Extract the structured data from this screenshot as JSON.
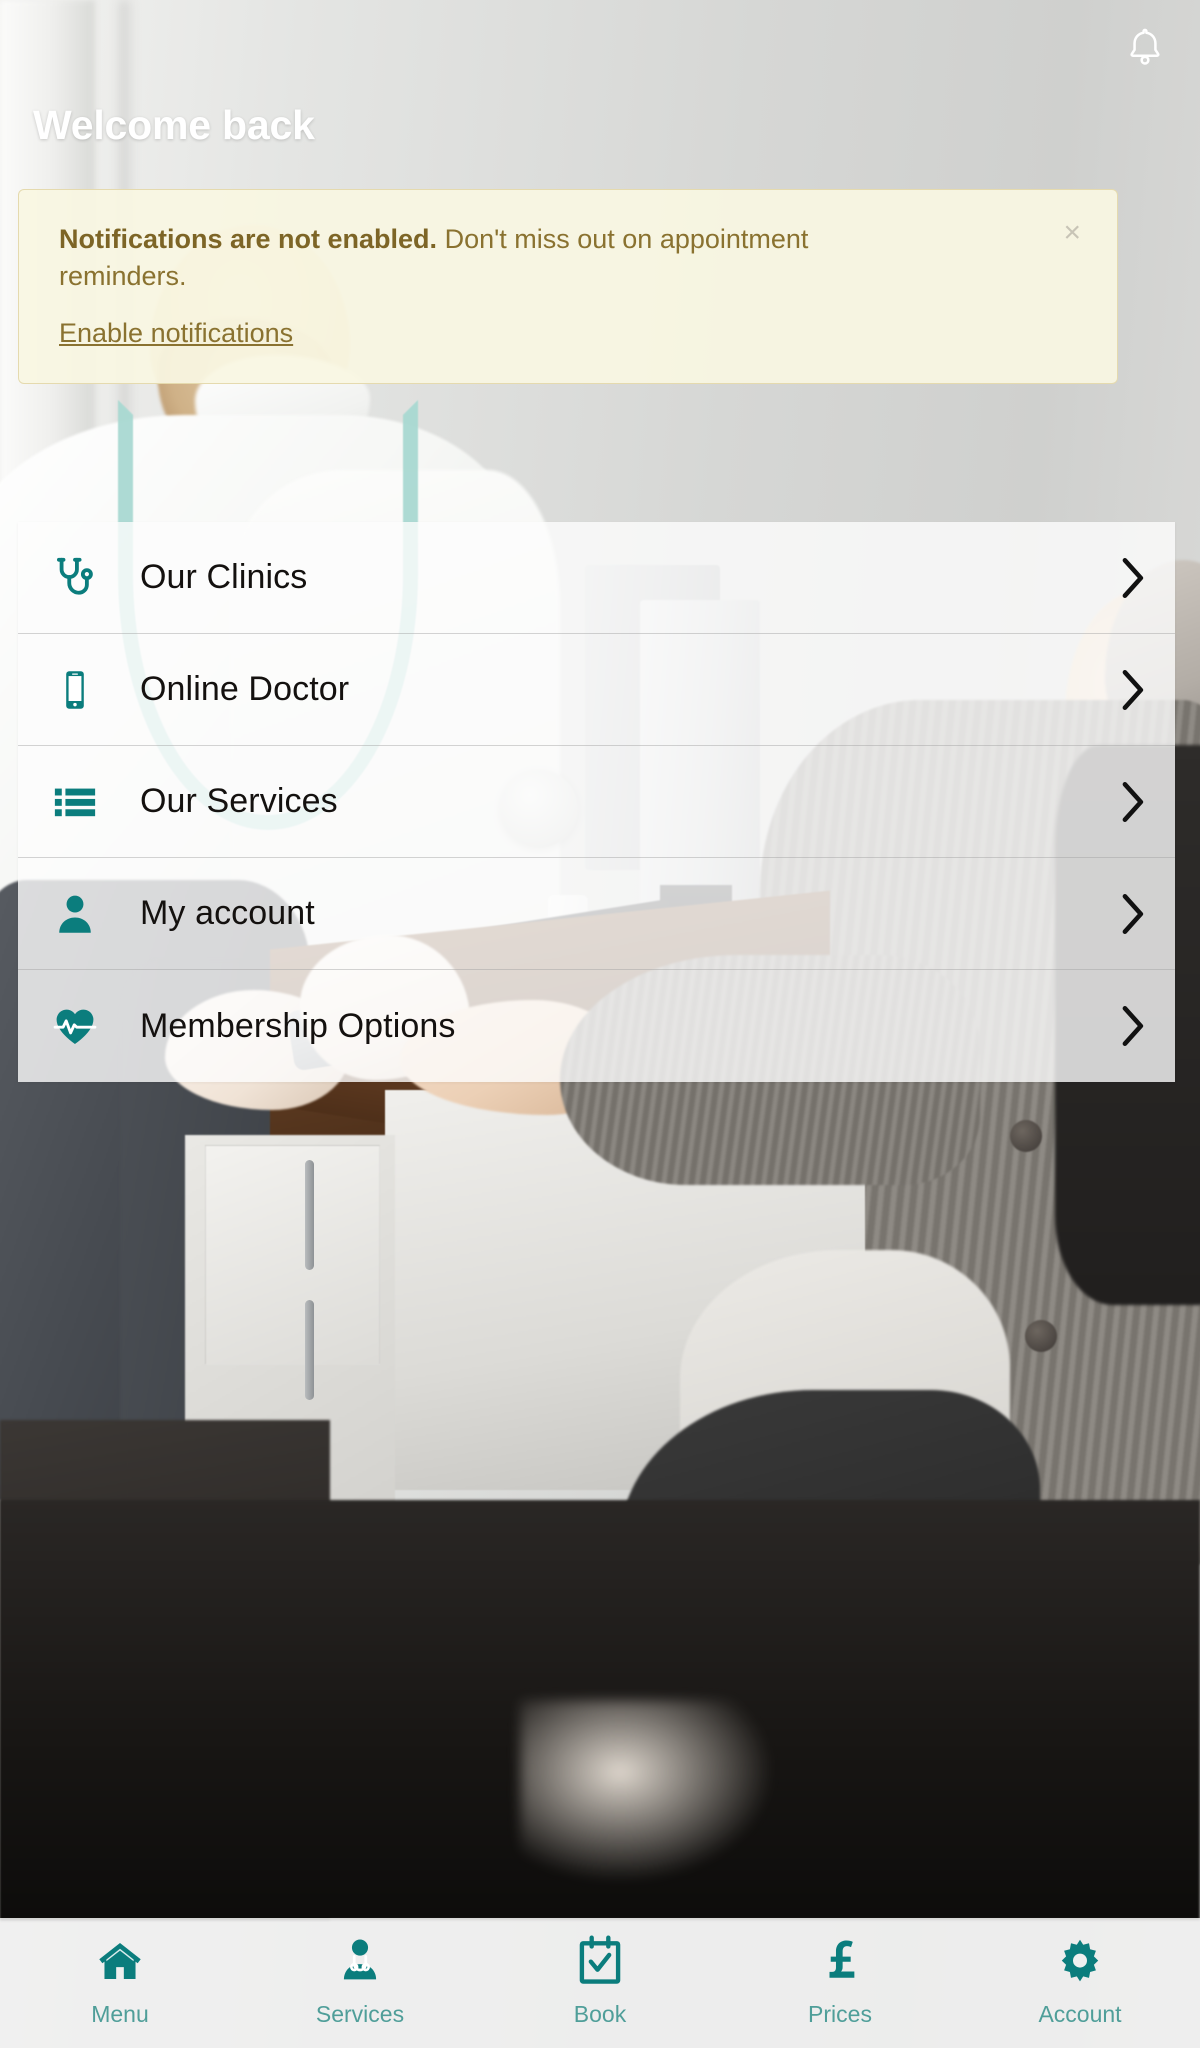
{
  "header": {
    "title": "Welcome back",
    "bell_icon": "bell-icon"
  },
  "banner": {
    "strong_text": "Notifications are not enabled.",
    "body_text": " Don't miss out on appointment reminders.",
    "link_label": "Enable notifications",
    "close_label": "×",
    "background_color": "#f9f6e2",
    "text_color": "#8a7230"
  },
  "menu": {
    "items": [
      {
        "label": "Our Clinics",
        "icon": "stethoscope-icon",
        "chevron": "chevron-right-icon"
      },
      {
        "label": "Online Doctor",
        "icon": "mobile-phone-icon",
        "chevron": "chevron-right-icon"
      },
      {
        "label": "Our Services",
        "icon": "list-icon",
        "chevron": "chevron-right-icon"
      },
      {
        "label": "My account",
        "icon": "user-icon",
        "chevron": "chevron-right-icon"
      },
      {
        "label": "Membership Options",
        "icon": "heart-pulse-icon",
        "chevron": "chevron-right-icon"
      }
    ]
  },
  "bottom_nav": {
    "items": [
      {
        "label": "Menu",
        "icon": "home-icon"
      },
      {
        "label": "Services",
        "icon": "doctor-icon"
      },
      {
        "label": "Book",
        "icon": "calendar-check-icon"
      },
      {
        "label": "Prices",
        "icon": "pound-sterling-icon"
      },
      {
        "label": "Account",
        "icon": "gear-icon"
      }
    ]
  },
  "colors": {
    "accent_teal": "#0b7d7d",
    "nav_label_teal": "#4f9e99",
    "banner_bg": "#f9f6e2",
    "banner_text": "#8a7230"
  }
}
